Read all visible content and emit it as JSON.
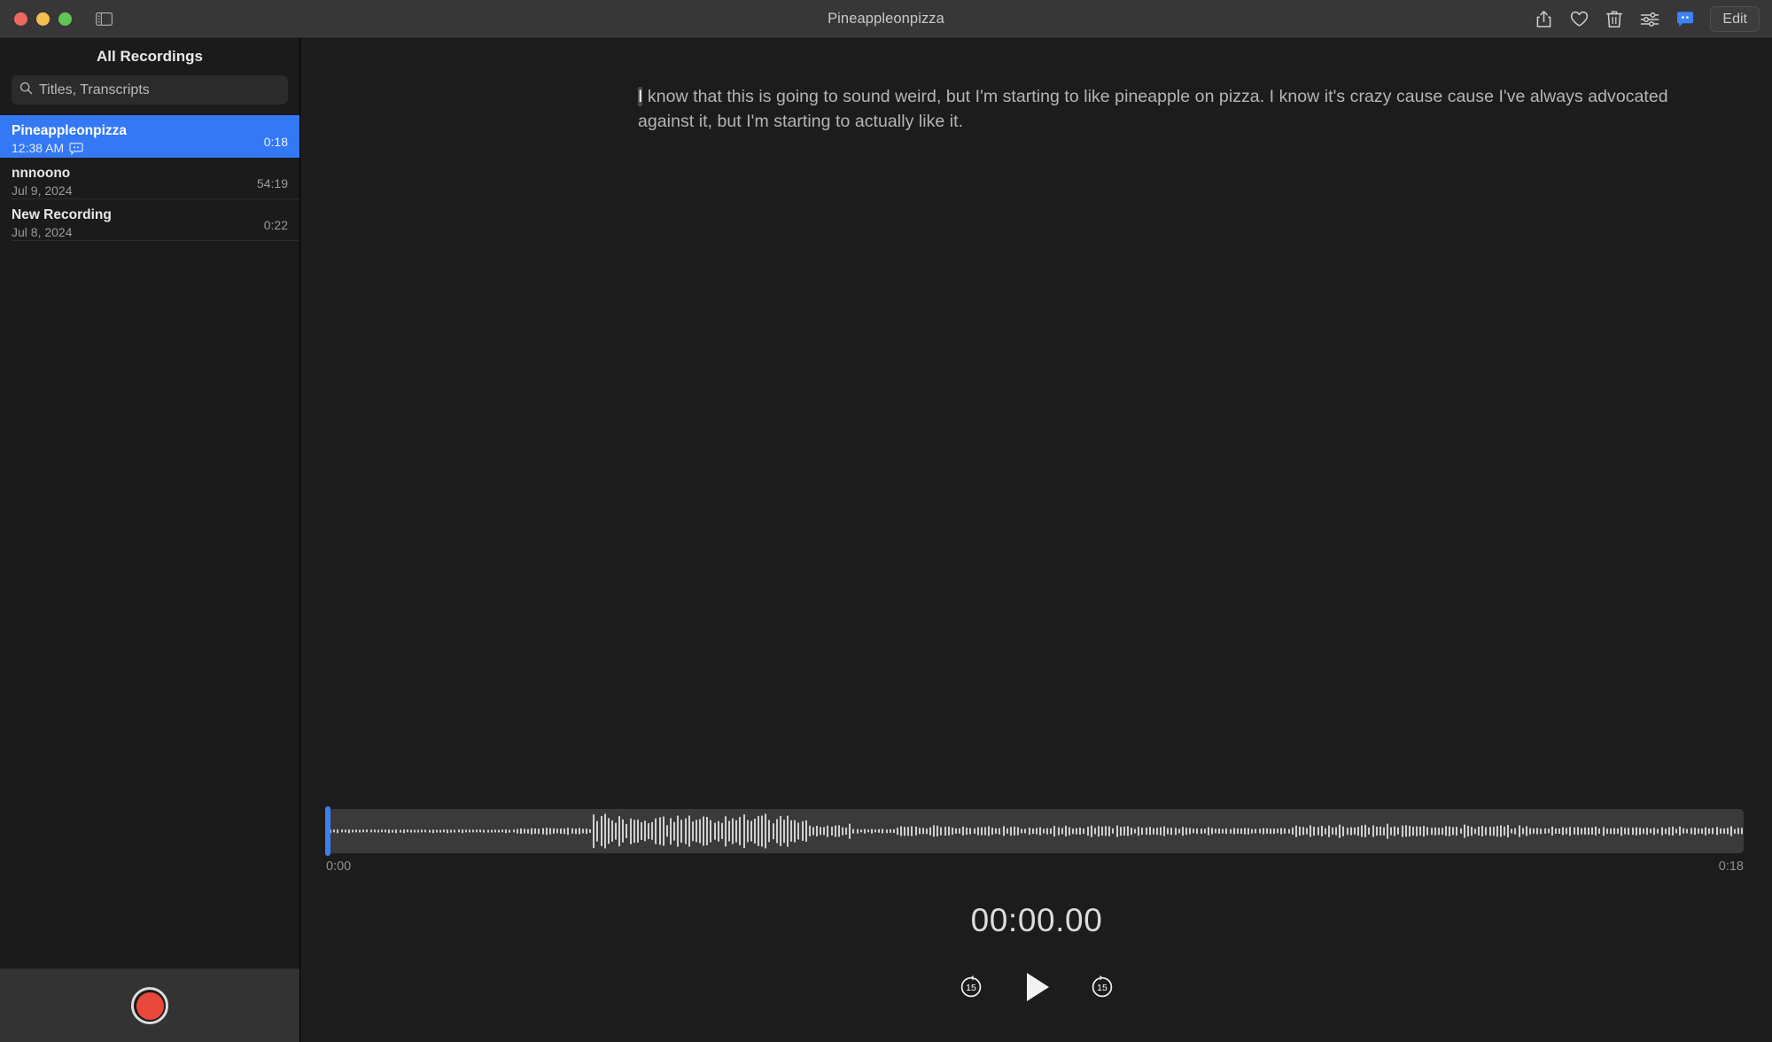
{
  "window": {
    "title": "Pineappleonpizza",
    "traffic_lights": {
      "close": "close",
      "minimize": "minimize",
      "zoom": "zoom"
    }
  },
  "toolbar": {
    "sidebar_toggle": "sidebar-toggle-icon",
    "share": "share-icon",
    "favorite": "heart-icon",
    "delete": "trash-icon",
    "audio_settings": "sliders-icon",
    "transcript": "transcript-bubble-icon",
    "edit_label": "Edit"
  },
  "sidebar": {
    "header": "All Recordings",
    "search": {
      "placeholder": "Titles, Transcripts",
      "value": ""
    },
    "recordings": [
      {
        "title": "Pineappleonpizza",
        "date": "12:38 AM",
        "duration": "0:18",
        "has_transcript": true,
        "selected": true
      },
      {
        "title": "nnnoono",
        "date": "Jul 9, 2024",
        "duration": "54:19",
        "has_transcript": false,
        "selected": false
      },
      {
        "title": "New Recording",
        "date": "Jul 8, 2024",
        "duration": "0:22",
        "has_transcript": false,
        "selected": false
      }
    ],
    "record_button": "record-button"
  },
  "main": {
    "transcript_current_word": "I",
    "transcript_rest": " know that this is going to sound weird, but I'm starting to like pineapple on pizza. I know it's crazy cause cause I've always advocated against it, but I'm starting to actually like it.",
    "player": {
      "start_time": "0:00",
      "end_time": "0:18",
      "elapsed": "00:00.00",
      "skip_back_label": "15",
      "skip_forward_label": "15",
      "play_label": "play-icon",
      "playhead_percent": 0
    }
  },
  "colors": {
    "accent_blue": "#3478f6",
    "record_red": "#e8483c",
    "titlebar": "#373737",
    "sidebar": "#1b1b1b",
    "main_bg": "#1c1c1c"
  }
}
